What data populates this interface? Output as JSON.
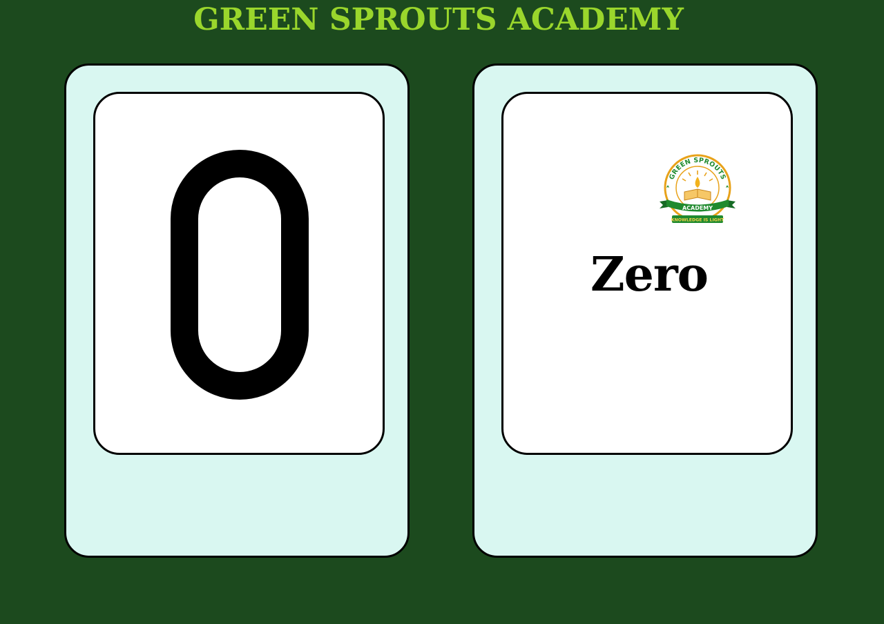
{
  "header": {
    "title": "GREEN SPROUTS ACADEMY"
  },
  "flashcard": {
    "numeral": "0",
    "word": "Zero"
  },
  "logo": {
    "top_text": "GREEN SPROUTS",
    "banner_text": "ACADEMY",
    "motto": "KNOWLEDGE IS LIGHT"
  },
  "colors": {
    "background": "#1c4a1e",
    "title": "#9ad62c",
    "card": "#d9f7f1",
    "inner_card": "#ffffff",
    "logo_ring": "#e8a21a",
    "logo_green": "#1f8a2e"
  }
}
